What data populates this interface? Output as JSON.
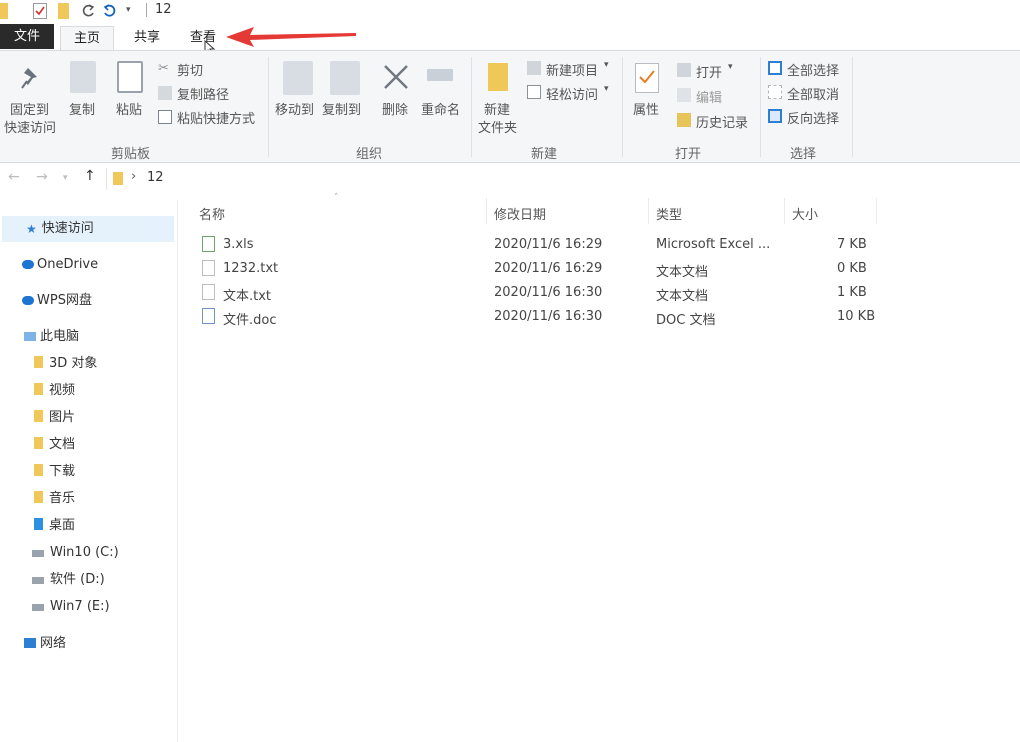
{
  "window": {
    "title": "12"
  },
  "tabs": {
    "file": "文件",
    "home": "主页",
    "share": "共享",
    "view": "查看"
  },
  "ribbon": {
    "clipboard": {
      "pin": "固定到",
      "pin2": "快速访问",
      "copy": "复制",
      "paste": "粘贴",
      "cut": "剪切",
      "copy_path": "复制路径",
      "paste_shortcut": "粘贴快捷方式",
      "group": "剪贴板"
    },
    "organize": {
      "move_to": "移动到",
      "copy_to": "复制到",
      "delete": "删除",
      "rename": "重命名",
      "group": "组织"
    },
    "new": {
      "new_folder": "新建",
      "new_folder2": "文件夹",
      "new_item": "新建项目",
      "easy_access": "轻松访问",
      "group": "新建"
    },
    "open": {
      "properties": "属性",
      "open": "打开",
      "edit": "编辑",
      "history": "历史记录",
      "group": "打开"
    },
    "select": {
      "select_all": "全部选择",
      "select_none": "全部取消",
      "invert": "反向选择",
      "group": "选择"
    }
  },
  "address": {
    "path": "12",
    "sep": "›"
  },
  "nav": {
    "quick_access": "快速访问",
    "onedrive": "OneDrive",
    "wps": "WPS网盘",
    "this_pc": "此电脑",
    "items": [
      "3D 对象",
      "视频",
      "图片",
      "文档",
      "下载",
      "音乐",
      "桌面",
      "Win10 (C:)",
      "软件 (D:)",
      "Win7 (E:)"
    ],
    "network": "网络"
  },
  "columns": {
    "name": "名称",
    "date": "修改日期",
    "type": "类型",
    "size": "大小"
  },
  "files": [
    {
      "name": "3.xls",
      "date": "2020/11/6 16:29",
      "type": "Microsoft Excel ...",
      "size": "7 KB"
    },
    {
      "name": "1232.txt",
      "date": "2020/11/6 16:29",
      "type": "文本文档",
      "size": "0 KB"
    },
    {
      "name": "文本.txt",
      "date": "2020/11/6 16:30",
      "type": "文本文档",
      "size": "1 KB"
    },
    {
      "name": "文件.doc",
      "date": "2020/11/6 16:30",
      "type": "DOC 文档",
      "size": "10 KB"
    }
  ],
  "colors": {
    "accent": "#0078d7",
    "arrow": "#e53935",
    "folder": "#f0c85a"
  }
}
